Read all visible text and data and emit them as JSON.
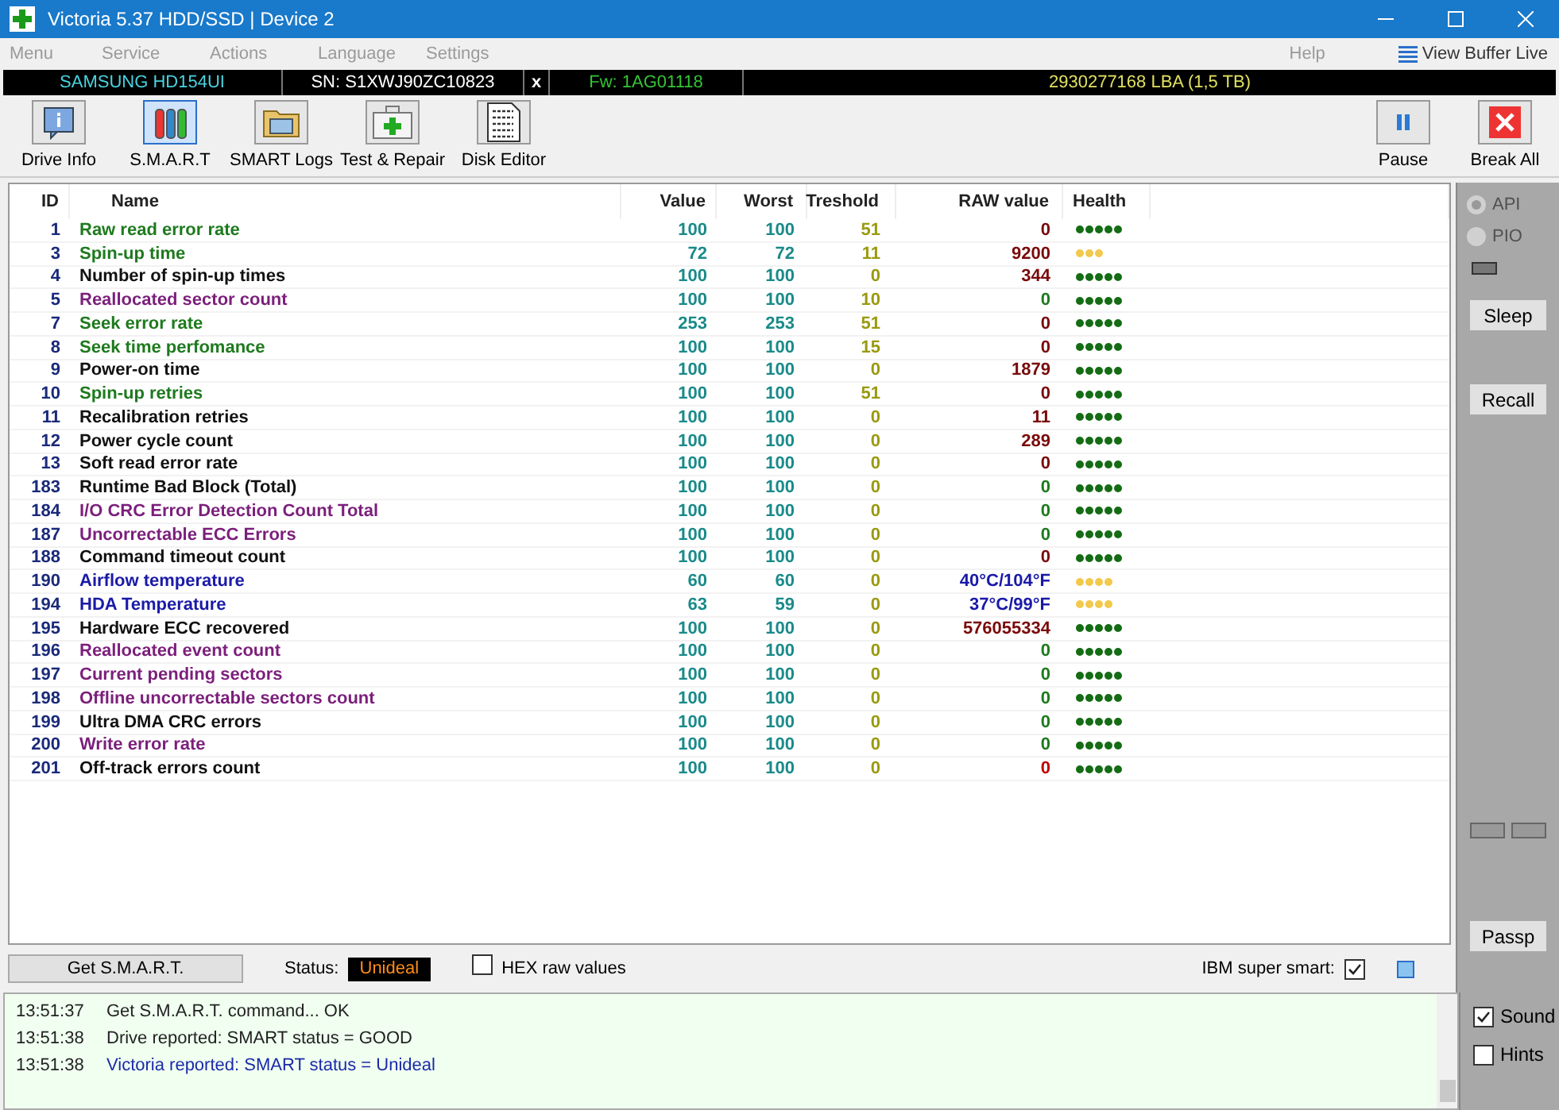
{
  "window": {
    "title": "Victoria 5.37 HDD/SSD | Device 2"
  },
  "menu": [
    {
      "label": "Menu"
    },
    {
      "label": "Service"
    },
    {
      "label": "Actions"
    },
    {
      "label": "Language"
    },
    {
      "label": "Settings"
    }
  ],
  "menu_right": {
    "help": "Help",
    "view_buffer": "View Buffer Live"
  },
  "device_bar": {
    "model": "SAMSUNG HD154UI",
    "serial": "SN: S1XWJ90ZC10823",
    "close": "x",
    "firmware": "Fw: 1AG01118",
    "capacity": "2930277168 LBA (1,5 TB)"
  },
  "toolbar": [
    {
      "label": "Drive Info",
      "kind": "info",
      "selected": false
    },
    {
      "label": "S.M.A.R.T",
      "kind": "smart",
      "selected": true
    },
    {
      "label": "SMART Logs",
      "kind": "logs",
      "selected": false
    },
    {
      "label": "Test & Repair",
      "kind": "test",
      "selected": false
    },
    {
      "label": "Disk Editor",
      "kind": "editor",
      "selected": false
    }
  ],
  "toolbar_right": [
    {
      "label": "Pause",
      "kind": "pause"
    },
    {
      "label": "Break All",
      "kind": "break"
    }
  ],
  "table": {
    "columns": [
      "ID",
      "Name",
      "Value",
      "Worst",
      "Treshold",
      "RAW value",
      "Health"
    ],
    "rows": [
      {
        "id": "1",
        "name": "Raw read error rate",
        "color": "#1e7a1e",
        "value": "100",
        "worst": "100",
        "threshold": "51",
        "raw": {
          "text": "0",
          "color": "#7a0a0a"
        },
        "stars": 5
      },
      {
        "id": "3",
        "name": "Spin-up time",
        "color": "#1e7a1e",
        "value": "72",
        "worst": "72",
        "threshold": "11",
        "raw": {
          "text": "9200",
          "color": "#7a0a0a"
        },
        "stars": 3
      },
      {
        "id": "4",
        "name": "Number of spin-up times",
        "color": "#111111",
        "value": "100",
        "worst": "100",
        "threshold": "0",
        "raw": {
          "text": "344",
          "color": "#7a0a0a"
        },
        "stars": 5
      },
      {
        "id": "5",
        "name": "Reallocated sector count",
        "color": "#7b1f7b",
        "value": "100",
        "worst": "100",
        "threshold": "10",
        "raw": {
          "text": "0",
          "color": "#1e7a1e"
        },
        "stars": 5
      },
      {
        "id": "7",
        "name": "Seek error rate",
        "color": "#1e7a1e",
        "value": "253",
        "worst": "253",
        "threshold": "51",
        "raw": {
          "text": "0",
          "color": "#7a0a0a"
        },
        "stars": 5
      },
      {
        "id": "8",
        "name": "Seek time perfomance",
        "color": "#1e7a1e",
        "value": "100",
        "worst": "100",
        "threshold": "15",
        "raw": {
          "text": "0",
          "color": "#7a0a0a"
        },
        "stars": 5
      },
      {
        "id": "9",
        "name": "Power-on time",
        "color": "#111111",
        "value": "100",
        "worst": "100",
        "threshold": "0",
        "raw": {
          "text": "1879",
          "color": "#7a0a0a"
        },
        "stars": 5
      },
      {
        "id": "10",
        "name": "Spin-up retries",
        "color": "#1e7a1e",
        "value": "100",
        "worst": "100",
        "threshold": "51",
        "raw": {
          "text": "0",
          "color": "#7a0a0a"
        },
        "stars": 5
      },
      {
        "id": "11",
        "name": "Recalibration retries",
        "color": "#111111",
        "value": "100",
        "worst": "100",
        "threshold": "0",
        "raw": {
          "text": "11",
          "color": "#7a0a0a"
        },
        "stars": 5
      },
      {
        "id": "12",
        "name": "Power cycle count",
        "color": "#111111",
        "value": "100",
        "worst": "100",
        "threshold": "0",
        "raw": {
          "text": "289",
          "color": "#7a0a0a"
        },
        "stars": 5
      },
      {
        "id": "13",
        "name": "Soft read error rate",
        "color": "#111111",
        "value": "100",
        "worst": "100",
        "threshold": "0",
        "raw": {
          "text": "0",
          "color": "#7a0a0a"
        },
        "stars": 5
      },
      {
        "id": "183",
        "name": "Runtime Bad Block (Total)",
        "color": "#111111",
        "value": "100",
        "worst": "100",
        "threshold": "0",
        "raw": {
          "text": "0",
          "color": "#1e7a1e"
        },
        "stars": 5
      },
      {
        "id": "184",
        "name": "I/O CRC Error Detection Count Total",
        "color": "#7b1f7b",
        "value": "100",
        "worst": "100",
        "threshold": "0",
        "raw": {
          "text": "0",
          "color": "#1e7a1e"
        },
        "stars": 5
      },
      {
        "id": "187",
        "name": "Uncorrectable ECC Errors",
        "color": "#7b1f7b",
        "value": "100",
        "worst": "100",
        "threshold": "0",
        "raw": {
          "text": "0",
          "color": "#1e7a1e"
        },
        "stars": 5
      },
      {
        "id": "188",
        "name": "Command timeout count",
        "color": "#111111",
        "value": "100",
        "worst": "100",
        "threshold": "0",
        "raw": {
          "text": "0",
          "color": "#7a0a0a"
        },
        "stars": 5
      },
      {
        "id": "190",
        "name": "Airflow temperature",
        "color": "#1a1aa8",
        "value": "60",
        "worst": "60",
        "threshold": "0",
        "raw": {
          "text": "40°C/104°F",
          "color": "#1a1aa8"
        },
        "stars": 4
      },
      {
        "id": "194",
        "name": "HDA Temperature",
        "color": "#1a1aa8",
        "value": "63",
        "worst": "59",
        "threshold": "0",
        "raw": {
          "text": "37°C/99°F",
          "color": "#1a1aa8"
        },
        "stars": 4
      },
      {
        "id": "195",
        "name": "Hardware ECC recovered",
        "color": "#111111",
        "value": "100",
        "worst": "100",
        "threshold": "0",
        "raw": {
          "text": "576055334",
          "color": "#7a0a0a"
        },
        "stars": 5
      },
      {
        "id": "196",
        "name": "Reallocated event count",
        "color": "#7b1f7b",
        "value": "100",
        "worst": "100",
        "threshold": "0",
        "raw": {
          "text": "0",
          "color": "#1e7a1e"
        },
        "stars": 5
      },
      {
        "id": "197",
        "name": "Current pending sectors",
        "color": "#7b1f7b",
        "value": "100",
        "worst": "100",
        "threshold": "0",
        "raw": {
          "text": "0",
          "color": "#1e7a1e"
        },
        "stars": 5
      },
      {
        "id": "198",
        "name": "Offline uncorrectable sectors count",
        "color": "#7b1f7b",
        "value": "100",
        "worst": "100",
        "threshold": "0",
        "raw": {
          "text": "0",
          "color": "#1e7a1e"
        },
        "stars": 5
      },
      {
        "id": "199",
        "name": "Ultra DMA CRC errors",
        "color": "#111111",
        "value": "100",
        "worst": "100",
        "threshold": "0",
        "raw": {
          "text": "0",
          "color": "#1e7a1e"
        },
        "stars": 5
      },
      {
        "id": "200",
        "name": "Write error rate",
        "color": "#7b1f7b",
        "value": "100",
        "worst": "100",
        "threshold": "0",
        "raw": {
          "text": "0",
          "color": "#1e7a1e"
        },
        "stars": 5
      },
      {
        "id": "201",
        "name": "Off-track errors count",
        "color": "#111111",
        "value": "100",
        "worst": "100",
        "threshold": "0",
        "raw": {
          "text": "0",
          "color": "#c00000"
        },
        "stars": 5
      }
    ]
  },
  "side_panel": {
    "radios": [
      {
        "label": "API",
        "selected": true,
        "disabled": true
      },
      {
        "label": "PIO",
        "selected": false,
        "disabled": true
      }
    ],
    "buttons": [
      {
        "label": "Sleep"
      },
      {
        "label": "Recall"
      }
    ],
    "passp": "Passp"
  },
  "bottom_bar": {
    "get_smart": "Get S.M.A.R.T.",
    "status_label": "Status:",
    "status": "Unideal",
    "hex": {
      "label": "HEX raw values",
      "checked": false
    },
    "ibm": {
      "label": "IBM super smart:",
      "checked": true
    }
  },
  "log": [
    {
      "time": "13:51:37",
      "text": "Get S.M.A.R.T. command... OK",
      "kind": "normal"
    },
    {
      "time": "13:51:38",
      "text": "Drive reported: SMART status = GOOD",
      "kind": "normal"
    },
    {
      "time": "13:51:38",
      "text": "Victoria reported: SMART status = Unideal",
      "kind": "info"
    }
  ],
  "log_options": [
    {
      "label": "Sound",
      "checked": true
    },
    {
      "label": "Hints",
      "checked": false
    }
  ]
}
